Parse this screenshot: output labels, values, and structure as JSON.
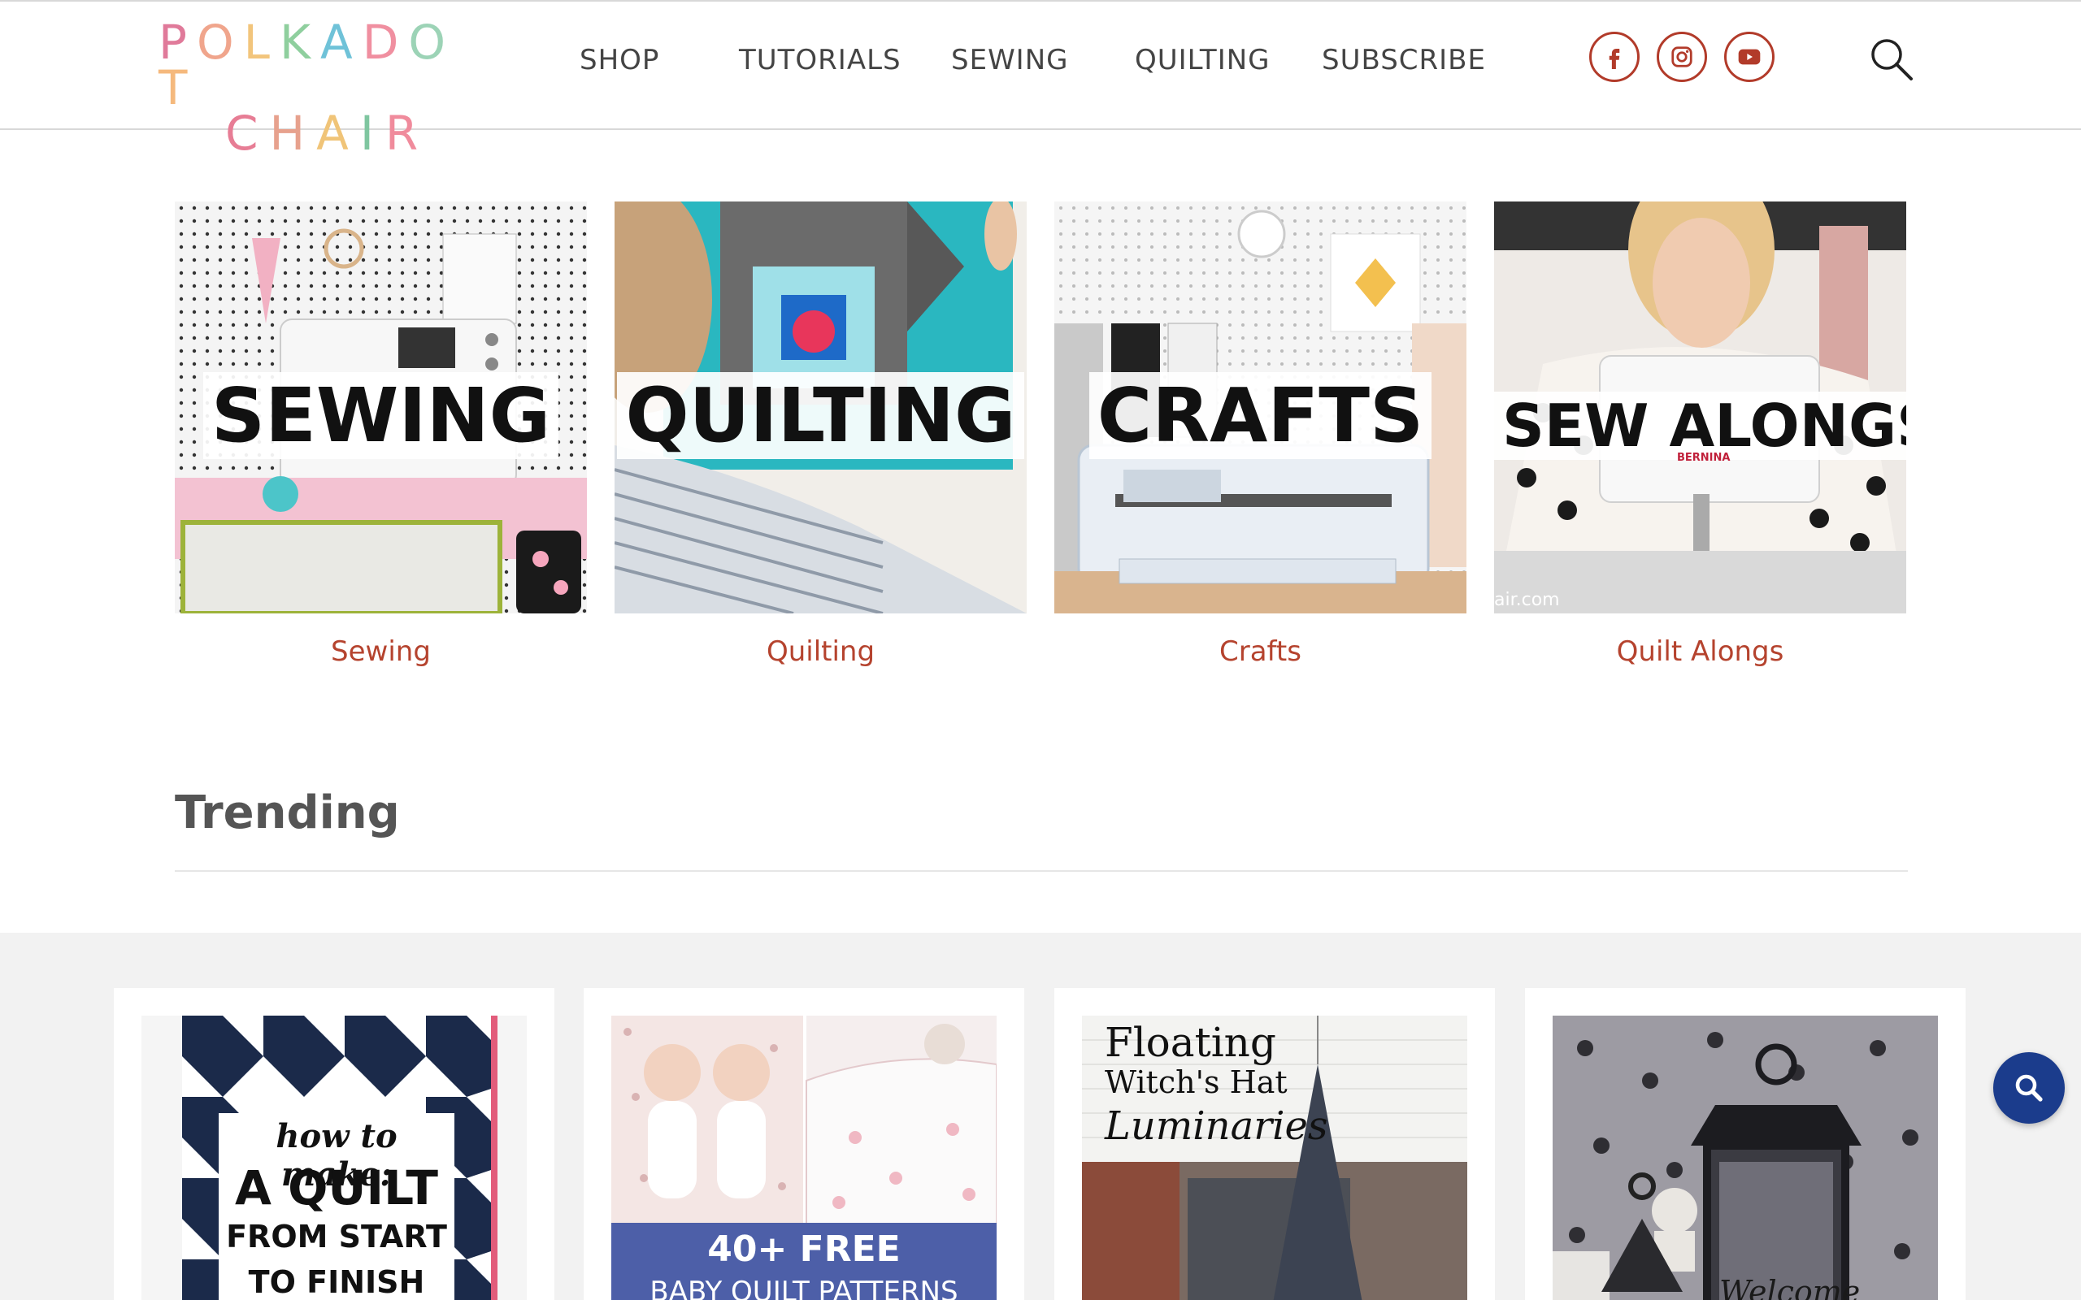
{
  "logo": {
    "line1": [
      "P",
      "O",
      "L",
      "K",
      "A",
      "D",
      "O",
      "T"
    ],
    "line2": [
      "C",
      "H",
      "A",
      "I",
      "R"
    ],
    "colors1": [
      "#e07a9a",
      "#f0a58c",
      "#f2c57c",
      "#8fcf9e",
      "#6fc2d8",
      "#f08fa0",
      "#9cd3b6",
      "#f5b97d"
    ],
    "colors2": [
      "#e77d95",
      "#e7a18d",
      "#f0c478",
      "#7fc6a0",
      "#f08b9c"
    ]
  },
  "nav": {
    "items": [
      "SHOP",
      "TUTORIALS",
      "SEWING",
      "QUILTING",
      "SUBSCRIBE"
    ]
  },
  "social": {
    "icons": [
      "facebook-icon",
      "instagram-icon",
      "youtube-icon"
    ],
    "accent": "#b23b2a"
  },
  "categories": [
    {
      "overlay": "SEWING",
      "caption": "Sewing"
    },
    {
      "overlay": "QUILTING",
      "caption": "Quilting"
    },
    {
      "overlay": "CRAFTS",
      "caption": "Crafts"
    },
    {
      "overlay": "SEW ALONGS",
      "caption": "Quilt Alongs",
      "badge": "BERNINA",
      "watermark": "air.com"
    }
  ],
  "trending": {
    "title": "Trending",
    "posts": [
      {
        "line1": "how to make:",
        "line2": "A QUILT",
        "line3": "FROM START",
        "line4": "TO FINISH"
      },
      {
        "line1": "40+ FREE",
        "line2": "BABY QUILT PATTERNS"
      },
      {
        "line1": "Floating",
        "line2": "Witch's Hat",
        "line3": "Luminaries"
      },
      {
        "line1": "Welcome"
      }
    ]
  },
  "colors": {
    "caption": "#b5432e",
    "fab": "#1b3c8c"
  }
}
